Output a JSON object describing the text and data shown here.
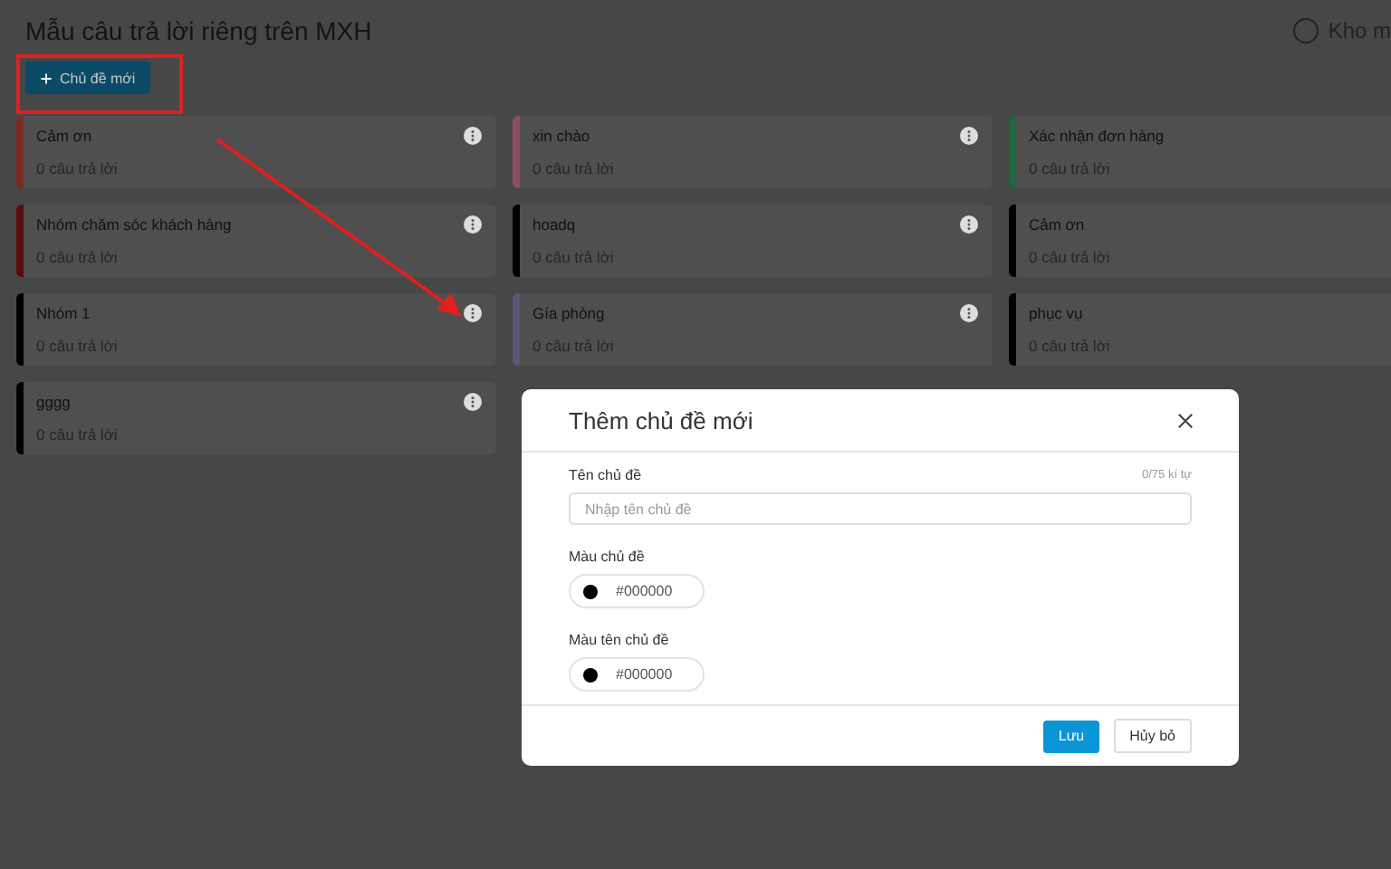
{
  "page": {
    "title": "Mẫu câu trả lời riêng trên MXH",
    "top_right_label": "Kho m",
    "new_topic_button": "Chủ đề mới"
  },
  "topics": [
    {
      "name": "Cảm ơn",
      "count": "0 câu trả lời",
      "color": "#7d2a23"
    },
    {
      "name": "xin chào",
      "count": "0 câu trả lời",
      "color": "#8f4a61"
    },
    {
      "name": "Xác nhận đơn hàng",
      "count": "0 câu trả lời",
      "color": "#1a6b3d"
    },
    {
      "name": "Nhóm chăm sóc khách hàng",
      "count": "0 câu trả lời",
      "color": "#5a0b0b"
    },
    {
      "name": "hoadq",
      "count": "0 câu trả lời",
      "color": "#000000"
    },
    {
      "name": "Cảm ơn",
      "count": "0 câu trả lời",
      "color": "#000000"
    },
    {
      "name": "Nhóm 1",
      "count": "0 câu trả lời",
      "color": "#000000"
    },
    {
      "name": "Gía phòng",
      "count": "0 câu trả lời",
      "color": "#5e5678"
    },
    {
      "name": "phục vụ",
      "count": "0 câu trả lời",
      "color": "#000000"
    },
    {
      "name": "gggg",
      "count": "0 câu trả lời",
      "color": "#000000"
    }
  ],
  "dialog": {
    "title": "Thêm chủ đề mới",
    "name_field": {
      "label": "Tên chủ đề",
      "counter": "0/75 kí tự",
      "placeholder": "Nhập tên chủ đề"
    },
    "color_fields": [
      {
        "label": "Màu chủ đề",
        "value": "#000000",
        "color": "#000000"
      },
      {
        "label": "Màu tên chủ đề",
        "value": "#000000",
        "color": "#000000"
      }
    ],
    "buttons": {
      "save": "Lưu",
      "cancel": "Hủy bỏ"
    }
  }
}
